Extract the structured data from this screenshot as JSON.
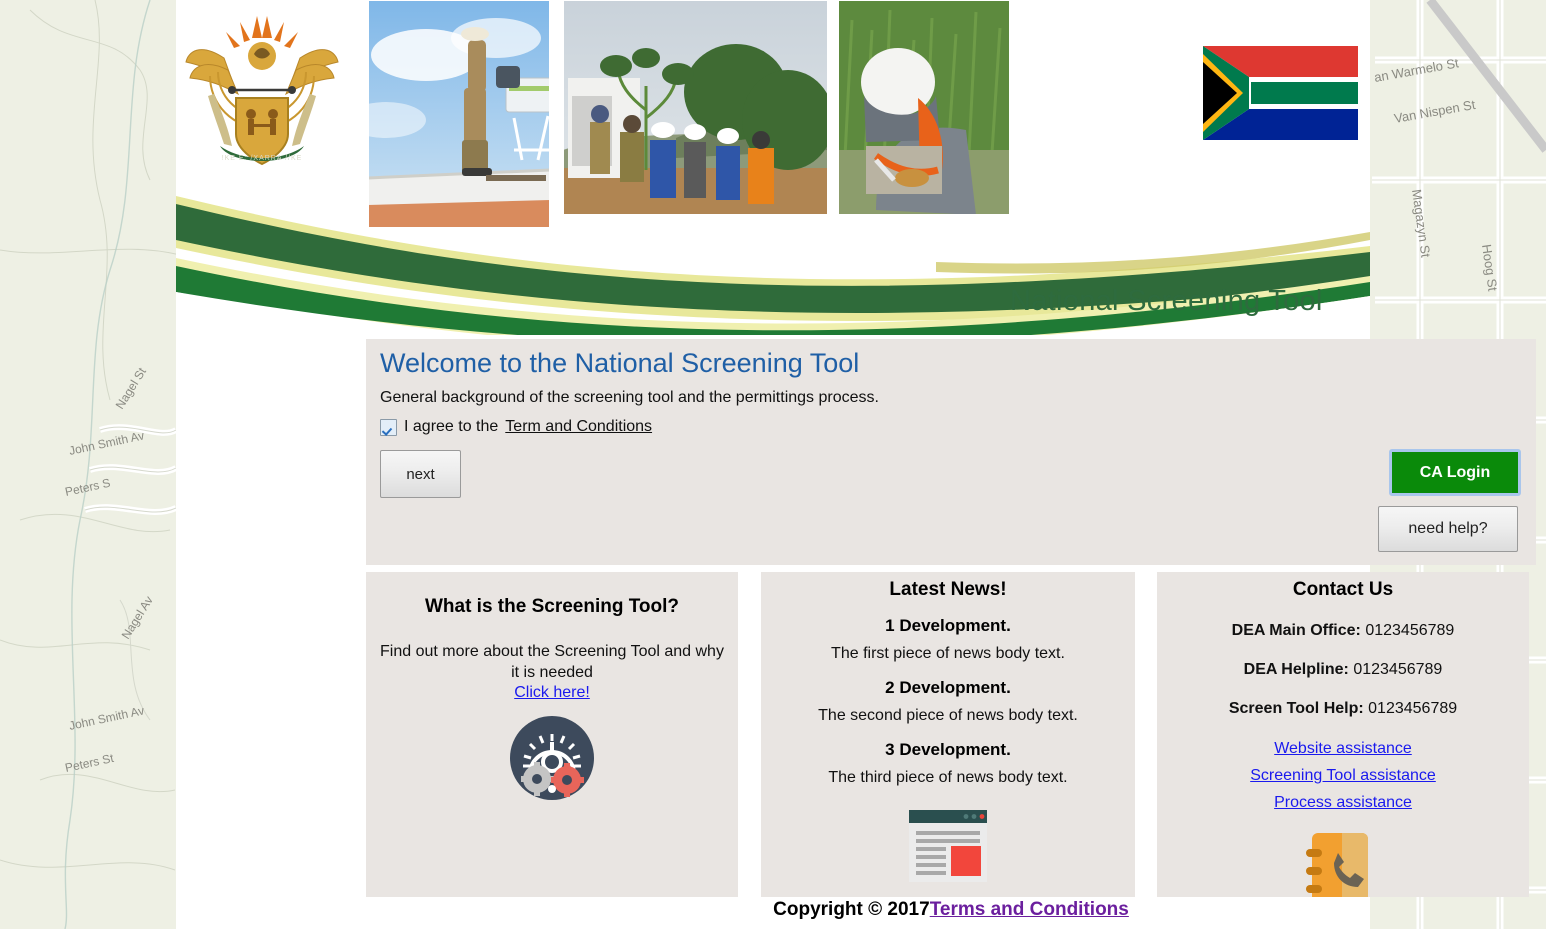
{
  "banner": {
    "title": "National Screening Tool",
    "coat_of_arms": "south-african-coat-of-arms",
    "flag": "south-african-flag",
    "photos": [
      "solar-water-heater-installation",
      "tree-planting-community",
      "field-worker-sampling"
    ]
  },
  "welcome": {
    "title": "Welcome to the National Screening Tool",
    "subtitle": "General background of the screening tool and the permittings process.",
    "agree_prefix": "I agree to the",
    "agree_link": "Term and Conditions",
    "agree_checked": true,
    "next_label": "next",
    "ca_login_label": "CA Login",
    "need_help_label": "need help?"
  },
  "about": {
    "title": "What is the Screening Tool?",
    "body": "Find out more about the Screening Tool and why it is needed",
    "link": "Click here!",
    "icon": "gears-icon"
  },
  "news": {
    "title": "Latest News!",
    "items": [
      {
        "heading": "1 Development.",
        "body": "The first piece of news body text."
      },
      {
        "heading": "2 Development.",
        "body": "The second piece of news body text."
      },
      {
        "heading": "3 Development.",
        "body": "The third piece of news body text."
      }
    ],
    "icon": "news-article-icon"
  },
  "contact": {
    "title": "Contact Us",
    "entries": [
      {
        "label": "DEA Main Office",
        "value": "0123456789"
      },
      {
        "label": "DEA Helpline",
        "value": "0123456789"
      },
      {
        "label": "Screen Tool Help",
        "value": "0123456789"
      }
    ],
    "links": [
      "Website assistance",
      "Screening Tool assistance",
      "Process assistance"
    ],
    "icon": "address-book-phone-icon"
  },
  "footer": {
    "copyright": "Copyright © 2017",
    "terms_link": "Terms and Conditions"
  },
  "background_map": {
    "streets_right": [
      "an Warmelo St",
      "Van Nispen St",
      "Magazyn St",
      "Hoog St"
    ],
    "streets_left": [
      "Nagel St",
      "John Smith Ave",
      "Peters St"
    ]
  },
  "colors": {
    "banner_green": "#2e6b3e",
    "swoosh_green": "#1f7a35",
    "heading_blue": "#1f5fa6",
    "login_green": "#0a8a0a",
    "panel_bg": "#e9e5e2",
    "link_blue": "#1a1aee",
    "visited_link": "#6b1f9e",
    "map_bg": "#eef0e4"
  }
}
